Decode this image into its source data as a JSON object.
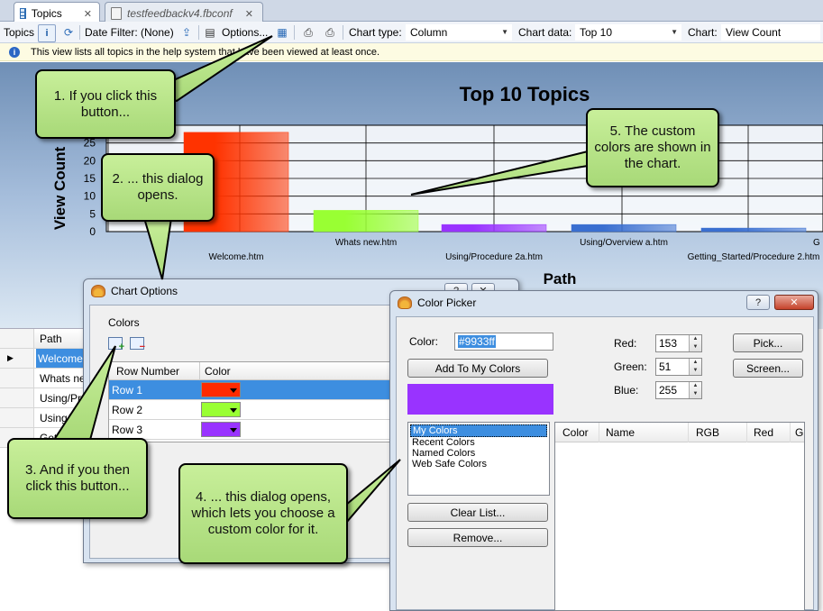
{
  "tabs": [
    {
      "label": "Topics",
      "icon": "grid-icon",
      "active": true,
      "close": "✕"
    },
    {
      "label": "testfeedbackv4.fbconf",
      "icon": "file-icon",
      "active": false,
      "close": "✕"
    }
  ],
  "toolbar": {
    "topics_label": "Topics",
    "date_filter": "Date Filter: (None)",
    "options_label": "Options...",
    "chart_type_label": "Chart type:",
    "chart_type_value": "Column",
    "chart_data_label": "Chart data:",
    "chart_data_value": "Top 10",
    "chart_label": "Chart:",
    "chart_value": "View Count"
  },
  "info_text": "This view lists all topics in the help system that have been viewed at least once.",
  "chart_data": {
    "type": "bar",
    "title": "Top 10 Topics",
    "ylabel": "View Count",
    "xlabel": "Path",
    "ylim": [
      0,
      30
    ],
    "yticks": [
      0,
      5,
      10,
      15,
      20,
      25
    ],
    "categories": [
      "Welcome.htm",
      "Whats new.htm",
      "Using/Procedure 2a.htm",
      "Using/Overview a.htm",
      "Getting_Started/Procedure 2.htm"
    ],
    "values": [
      28,
      6,
      2,
      2,
      1
    ],
    "colors": [
      "#ff3300",
      "#99ff33",
      "#9933ff",
      "#3a6fd0",
      "#3a6fd0"
    ],
    "truncated_label": "G"
  },
  "path_grid": {
    "header": "Path",
    "rows": [
      "Welcome.htm",
      "Whats new.htm",
      "Using/Procedure 2a.htm",
      "Using/Overview a.htm",
      "Getting_Started"
    ]
  },
  "chart_options": {
    "title": "Chart Options",
    "group_label": "Colors",
    "columns": [
      "Row Number",
      "Color"
    ],
    "rows": [
      {
        "label": "Row 1",
        "color": "#ff2a00"
      },
      {
        "label": "Row 2",
        "color": "#99ff33"
      },
      {
        "label": "Row 3",
        "color": "#9933ff"
      }
    ],
    "help_btn": "?",
    "close_btn": "✕"
  },
  "color_picker": {
    "title": "Color Picker",
    "color_label": "Color:",
    "color_value": "#9933ff",
    "add_btn": "Add To My Colors",
    "preview_color": "#9933ff",
    "red_label": "Red:",
    "red_value": "153",
    "green_label": "Green:",
    "green_value": "51",
    "blue_label": "Blue:",
    "blue_value": "255",
    "pick_btn": "Pick...",
    "screen_btn": "Screen...",
    "lists": [
      "My Colors",
      "Recent Colors",
      "Named Colors",
      "Web Safe Colors"
    ],
    "clear_btn": "Clear List...",
    "remove_btn": "Remove...",
    "table_columns": [
      "Color",
      "Name",
      "RGB",
      "Red",
      "G"
    ],
    "help_btn": "?",
    "close_btn": "✕"
  },
  "callouts": {
    "c1": "1. If you click this button...",
    "c2": "2. ... this dialog opens.",
    "c3": "3. And if you then click this button...",
    "c4": "4. ... this dialog opens, which lets you choose a custom color for it.",
    "c5": "5. The custom colors are shown in the chart."
  }
}
